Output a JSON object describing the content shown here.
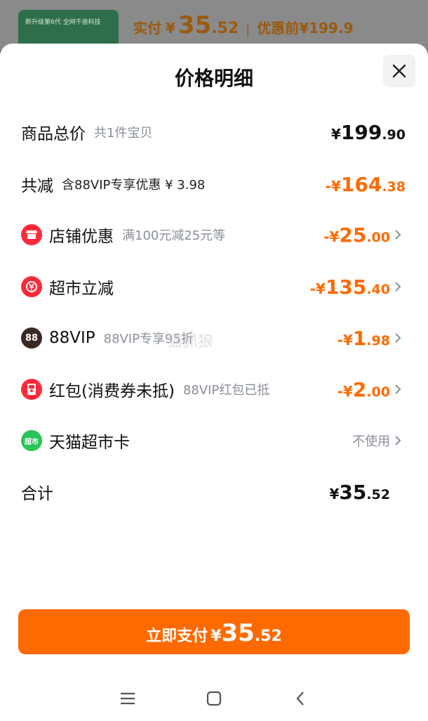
{
  "backdrop": {
    "thumb_text": "新升级第6代 全网千亩科技",
    "paid_label": "实付",
    "currency": "¥",
    "paid_int": "35",
    "paid_dec": ".52",
    "separator": "|",
    "original_label": "优惠前",
    "original_price": "¥199.9"
  },
  "sheet": {
    "title": "价格明细",
    "close_icon": "close-icon"
  },
  "rows": [
    {
      "label": "商品总价",
      "sub": "共1件宝贝",
      "cur": "¥",
      "int": "199",
      "dec": ".90",
      "style": "black"
    },
    {
      "label": "共减",
      "sub": "含88VIP专享优惠 ¥ 3.98",
      "cur": "-¥",
      "int": "164",
      "dec": ".38",
      "style": "orange"
    },
    {
      "label": "店铺优惠",
      "sub": "满100元减25元等",
      "cur": "-¥",
      "int": "25",
      "dec": ".00",
      "style": "orange",
      "icon": "shop-icon",
      "icon_color": "#ff2a3a"
    },
    {
      "label": "超市立减",
      "sub": "",
      "cur": "-¥",
      "int": "135",
      "dec": ".40",
      "style": "orange",
      "icon": "yen-coupon-icon",
      "icon_color": "#ff2a3a"
    },
    {
      "label": "88VIP",
      "sub": "88VIP专享95折",
      "cur": "-¥",
      "int": "1",
      "dec": ".98",
      "style": "orange",
      "icon": "vip88-icon",
      "icon_color": "#3a2a22",
      "icon_text": "88"
    },
    {
      "label": "红包(消费券未抵)",
      "sub": "88VIP红包已抵",
      "cur": "-¥",
      "int": "2",
      "dec": ".00",
      "style": "orange",
      "icon": "red-packet-icon",
      "icon_color": "#ff2a3a"
    },
    {
      "label": "天猫超市卡",
      "sub": "",
      "action": "不使用",
      "icon": "tmall-supermarket-icon",
      "icon_color": "#2bc45a",
      "icon_text": "超市"
    },
    {
      "label": "合计",
      "sub": "",
      "cur": "¥",
      "int": "35",
      "dec": ".52",
      "style": "black"
    }
  ],
  "pay_button": {
    "label": "立即支付",
    "cur": "¥",
    "int": "35",
    "dec": ".52"
  },
  "watermark": "猫抓狼",
  "colors": {
    "accent": "#ff6a00",
    "red_icon": "#ff2a3a",
    "muted": "#8a8f9a"
  },
  "nav": [
    "menu-icon",
    "home-icon",
    "back-icon"
  ]
}
